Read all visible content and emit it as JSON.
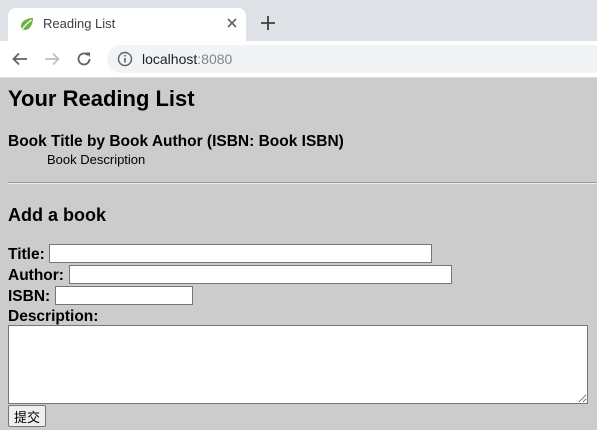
{
  "browser": {
    "tab_title": "Reading List",
    "url_host": "localhost",
    "url_port": ":8080",
    "favicon_color": "#6db33f"
  },
  "page": {
    "title": "Your Reading List",
    "books": [
      {
        "entry": "Book Title by Book Author (ISBN: Book ISBN)",
        "description": "Book Description"
      }
    ],
    "form": {
      "heading": "Add a book",
      "title_label": "Title:",
      "author_label": "Author:",
      "isbn_label": "ISBN:",
      "description_label": "Description:",
      "title_value": "",
      "author_value": "",
      "isbn_value": "",
      "description_value": "",
      "submit_label": "提交"
    }
  }
}
